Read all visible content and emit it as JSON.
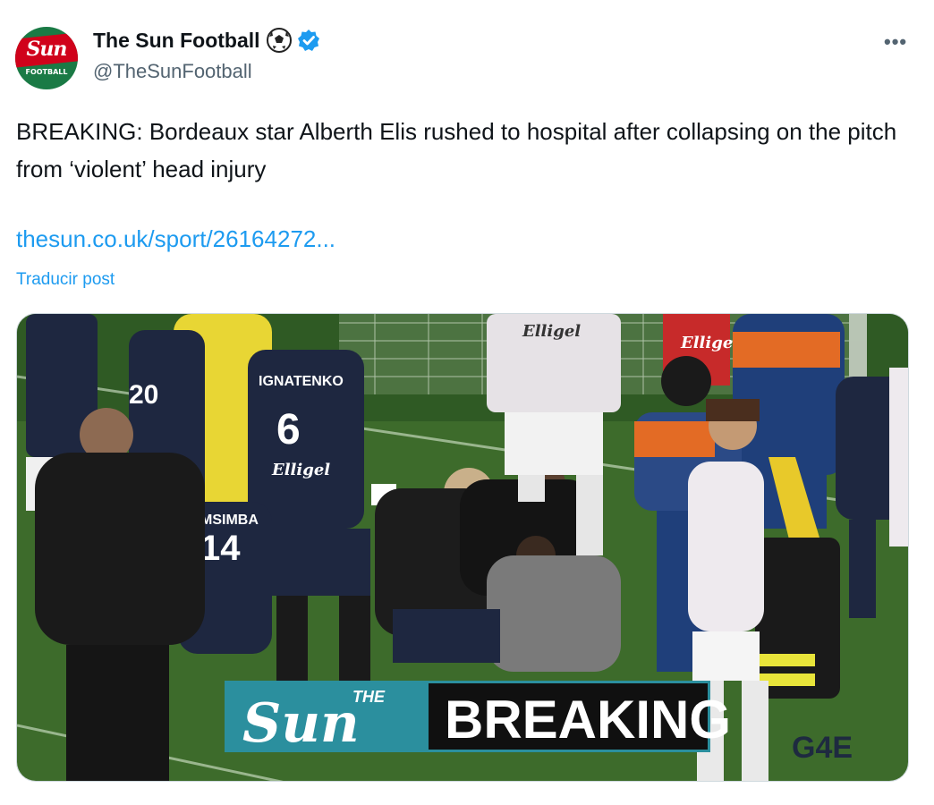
{
  "author": {
    "display_name": "The Sun Football",
    "handle": "@TheSunFootball",
    "avatar": {
      "logo_text": "Sun",
      "sub_text": "FOOTBALL"
    },
    "emoji_icon": "soccer-ball-icon",
    "verified_icon": "verified-badge-icon"
  },
  "post": {
    "text": "BREAKING: Bordeaux star Alberth Elis rushed to hospital after collapsing on the pitch from ‘violent’ head injury",
    "link": "thesun.co.uk/sport/26164272...",
    "translate_label": "Traducir post",
    "more_icon": "more-options-icon"
  },
  "media": {
    "banner": {
      "the": "THE",
      "sun": "Sun",
      "breaking": "BREAKING"
    },
    "jerseys": {
      "player6_name": "IGNATENKO",
      "player6_number": "6",
      "player14_name": "MSIMBA",
      "player14_number": "14",
      "player20_number": "20",
      "sponsor": "Elligel"
    },
    "watermark": "G4E"
  },
  "colors": {
    "text": "#0f1419",
    "secondary": "#536471",
    "link": "#1d9bf0",
    "verified": "#1d9bf0",
    "banner_teal": "#2b8f9e",
    "pitch": "#3d6b2b"
  }
}
